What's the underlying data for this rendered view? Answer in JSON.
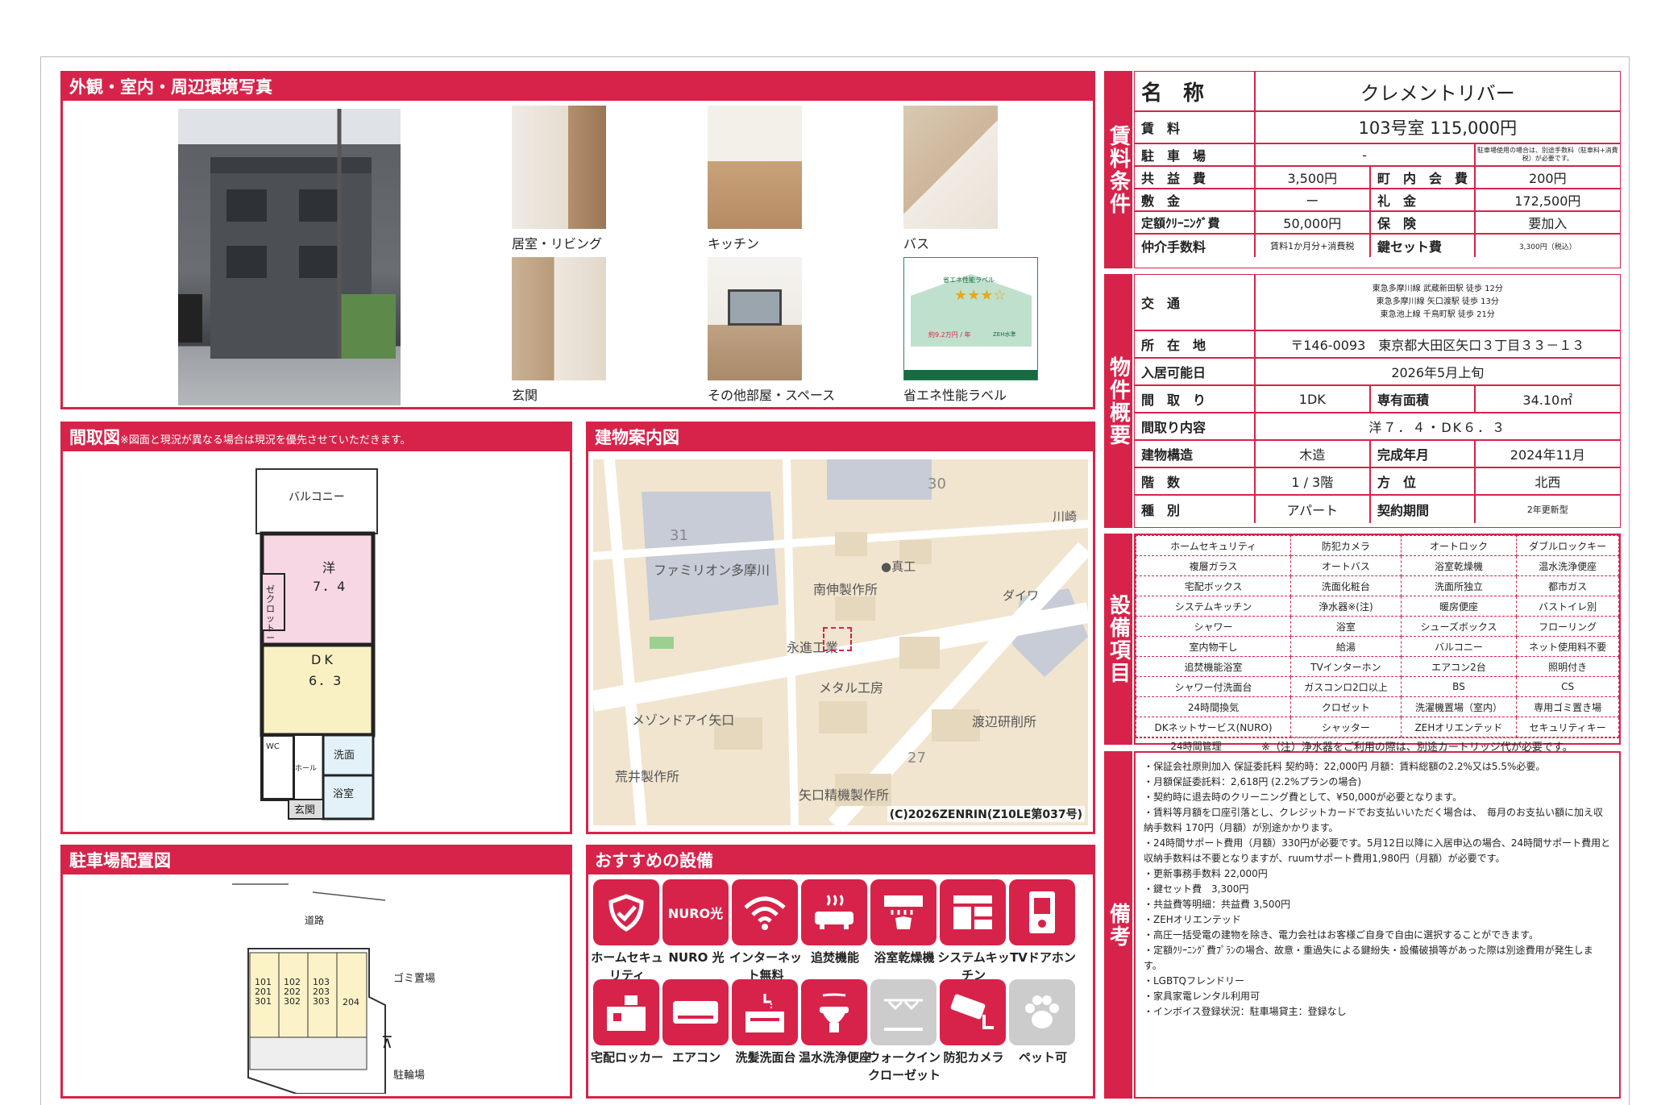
{
  "photos": {
    "title": "外観・室内・周辺環境写真",
    "captions": [
      "居室・リビング",
      "キッチン",
      "バス",
      "玄関",
      "その他部屋・スペース",
      "省エネ性能ラベル"
    ]
  },
  "madori": {
    "title": "間取図",
    "note": "※図面と現況が異なる場合は現況を優先させていただきます。",
    "balcony": "バルコニー",
    "room1": "洋",
    "room1_size": "7．4",
    "closet": "ゼクロ\nットー",
    "room2": "DK",
    "room2_size": "6．3",
    "wc": "WC",
    "hall": "ホール",
    "wash": "洗面",
    "bath": "浴室",
    "entrance": "玄関"
  },
  "map": {
    "title": "建物案内図",
    "labels": [
      "ファミリオン多摩川",
      "南伸製作所",
      "●真工",
      "ダイワ",
      "永進工業",
      "メタル工房",
      "メゾンドアイ矢口",
      "渡辺研削所",
      "荒井製作所",
      "矢口精機製作所",
      "川崎",
      "31",
      "30",
      "27"
    ],
    "copyright": "(C)2026ZENRIN(Z10LE第037号)"
  },
  "parking": {
    "title": "駐車場配置図",
    "road": "道路",
    "garbage": "ゴミ置場",
    "bike": "駐輪場",
    "rooms": [
      "101\n201\n301",
      "102\n202\n302",
      "103\n203\n303",
      "204"
    ]
  },
  "recommend": {
    "title": "おすすめの設備",
    "items": [
      "ホームセキュリティ",
      "NURO 光",
      "インターネット無料",
      "追焚機能",
      "浴室乾燥機",
      "システムキッチン",
      "TVドアホン",
      "宅配ロッカー",
      "エアコン",
      "洗髪洗面台",
      "温水洗浄便座",
      "ウォークインクローゼット",
      "防犯カメラ",
      "ペット可"
    ]
  },
  "rent": {
    "side": "賃料条件",
    "name_label": "名　称",
    "name": "クレメントリバー",
    "rent_label": "賃　料",
    "rent": "103号室 115,000円",
    "parking_label": "駐　車　場",
    "parking": "-",
    "parking_note": "駐車場使用の場合は、別途手数料（駐車料+消費税）が必要です。",
    "common_label": "共　益　費",
    "common": "3,500円",
    "town_label": "町　内　会　費",
    "town": "200円",
    "deposit_label": "敷　金",
    "deposit": "ー",
    "key_money_label": "礼　金",
    "key_money": "172,500円",
    "cleaning_label": "定額ｸﾘｰﾆﾝｸﾞ費",
    "cleaning": "50,000円",
    "insurance_label": "保　険",
    "insurance": "要加入",
    "brokerage_label": "仲介手数料",
    "brokerage": "賃料1か月分+消費税",
    "keyset_label": "鍵セット費",
    "keyset": "3,300円（税込）"
  },
  "property": {
    "side": "物件概要",
    "access_label": "交　通",
    "access": [
      "東急多摩川線 武蔵新田駅 徒歩 12分",
      "東急多摩川線 矢口渡駅 徒歩 13分",
      "東急池上線 千鳥町駅 徒歩 21分"
    ],
    "address_label": "所　在　地",
    "address": "〒146-0093　東京都大田区矢口３丁目３３－１３",
    "movein_label": "入居可能日",
    "movein": "2026年5月上旬",
    "layout_label": "間　取　り",
    "layout": "1DK",
    "area_label": "専有面積",
    "area": "34.10㎡",
    "detail_label": "間取り内容",
    "detail": "洋７．４・DK６．３",
    "structure_label": "建物構造",
    "structure": "木造",
    "built_label": "完成年月",
    "built": "2024年11月",
    "floor_label": "階　数",
    "floor": "1 / 3階",
    "direction_label": "方　位",
    "direction": "北西",
    "type_label": "種　別",
    "type": "アパート",
    "contract_label": "契約期間",
    "contract": "2年更新型"
  },
  "equipment": {
    "side": "設備項目",
    "rows": [
      [
        "ホームセキュリティ",
        "防犯カメラ",
        "オートロック",
        "ダブルロックキー"
      ],
      [
        "複層ガラス",
        "オートバス",
        "浴室乾燥機",
        "温水洗浄便座"
      ],
      [
        "宅配ボックス",
        "洗面化粧台",
        "洗面所独立",
        "都市ガス"
      ],
      [
        "システムキッチン",
        "浄水器※(注)",
        "暖房便座",
        "バストイレ別"
      ],
      [
        "シャワー",
        "浴室",
        "シューズボックス",
        "フローリング"
      ],
      [
        "室内物干し",
        "給湯",
        "バルコニー",
        "ネット使用料不要"
      ],
      [
        "追焚機能浴室",
        "TVインターホン",
        "エアコン2台",
        "照明付き"
      ],
      [
        "シャワー付洗面台",
        "ガスコンロ2口以上",
        "BS",
        "CS"
      ],
      [
        "24時間換気",
        "クロゼット",
        "洗濯機置場（室内）",
        "専用ゴミ置き場"
      ],
      [
        "DKネットサービス(NURO)",
        "シャッター",
        "ZEHオリエンテッド",
        "セキュリティキー"
      ]
    ],
    "last_item": "24時間管理",
    "last_note": "※（注）浄水器をご利用の際は、別途カートリッジ代が必要です。"
  },
  "remarks": {
    "side": "備考",
    "lines": [
      "・保証会社原則加入 保証委託料 契約時：22,000円 月額：賃料総額の2.2%又は5.5%必要。",
      "・月額保証委託料：2,618円 (2.2%プランの場合)",
      "・契約時に退去時のクリーニング費として、¥50,000が必要となります。",
      "・賃料等月額を口座引落とし、クレジットカードでお支払いいただく場合は、　毎月のお支払い額に加え収納手数料 170円（月額）が別途かかります。",
      "・24時間サポート費用（月額）330円が必要です。5月12日以降に入居申込の場合、24時間サポート費用と収納手数料は不要となりますが、ruumサポート費用1,980円（月額）が必要です。",
      "・更新事務手数料 22,000円",
      "・鍵セット費　3,300円",
      "・共益費等明細：共益費 3,500円",
      "・ZEHオリエンテッド",
      "・高圧一括受電の建物を除き、電力会社はお客様ご自身で自由に選択することができます。",
      "・定額ｸﾘｰﾆﾝｸﾞ費ﾌﾟﾗﾝの場合、故意・重過失による鍵紛失・設備破損等があった際は別途費用が発生します。",
      "・LGBTQフレンドリー",
      "・家具家電レンタル利用可",
      "・インボイス登録状況：駐車場貸主：登録なし"
    ]
  },
  "energy_label": {
    "title": "省エネ性能ラベル",
    "stars": "★★★☆",
    "cost": "約9.2万円 / 年",
    "zeh": "ZEH水準"
  },
  "colors": {
    "accent": "#d7234a"
  }
}
